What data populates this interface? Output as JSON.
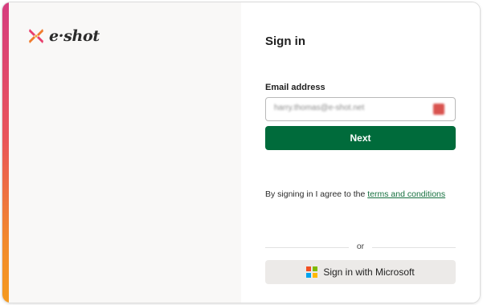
{
  "brand": {
    "name": "e·shot"
  },
  "signin": {
    "title": "Sign in",
    "email_label": "Email address",
    "email_value": "harry.thomas@e-shot.net",
    "next_label": "Next",
    "terms_prefix": "By signing in I agree to the ",
    "terms_link": "terms and conditions",
    "divider_text": "or",
    "microsoft_label": "Sign in with Microsoft"
  },
  "colors": {
    "primary_button": "#006b3b",
    "link": "#16703f",
    "accent_gradient": [
      "#d63d7f",
      "#f59a1f"
    ],
    "microsoft_logo": [
      "#f25022",
      "#7fba00",
      "#00a4ef",
      "#ffb900"
    ]
  },
  "icons": {
    "brand": "eshot-logo-icon",
    "autofill": "password-manager-icon",
    "microsoft": "microsoft-logo-icon"
  }
}
